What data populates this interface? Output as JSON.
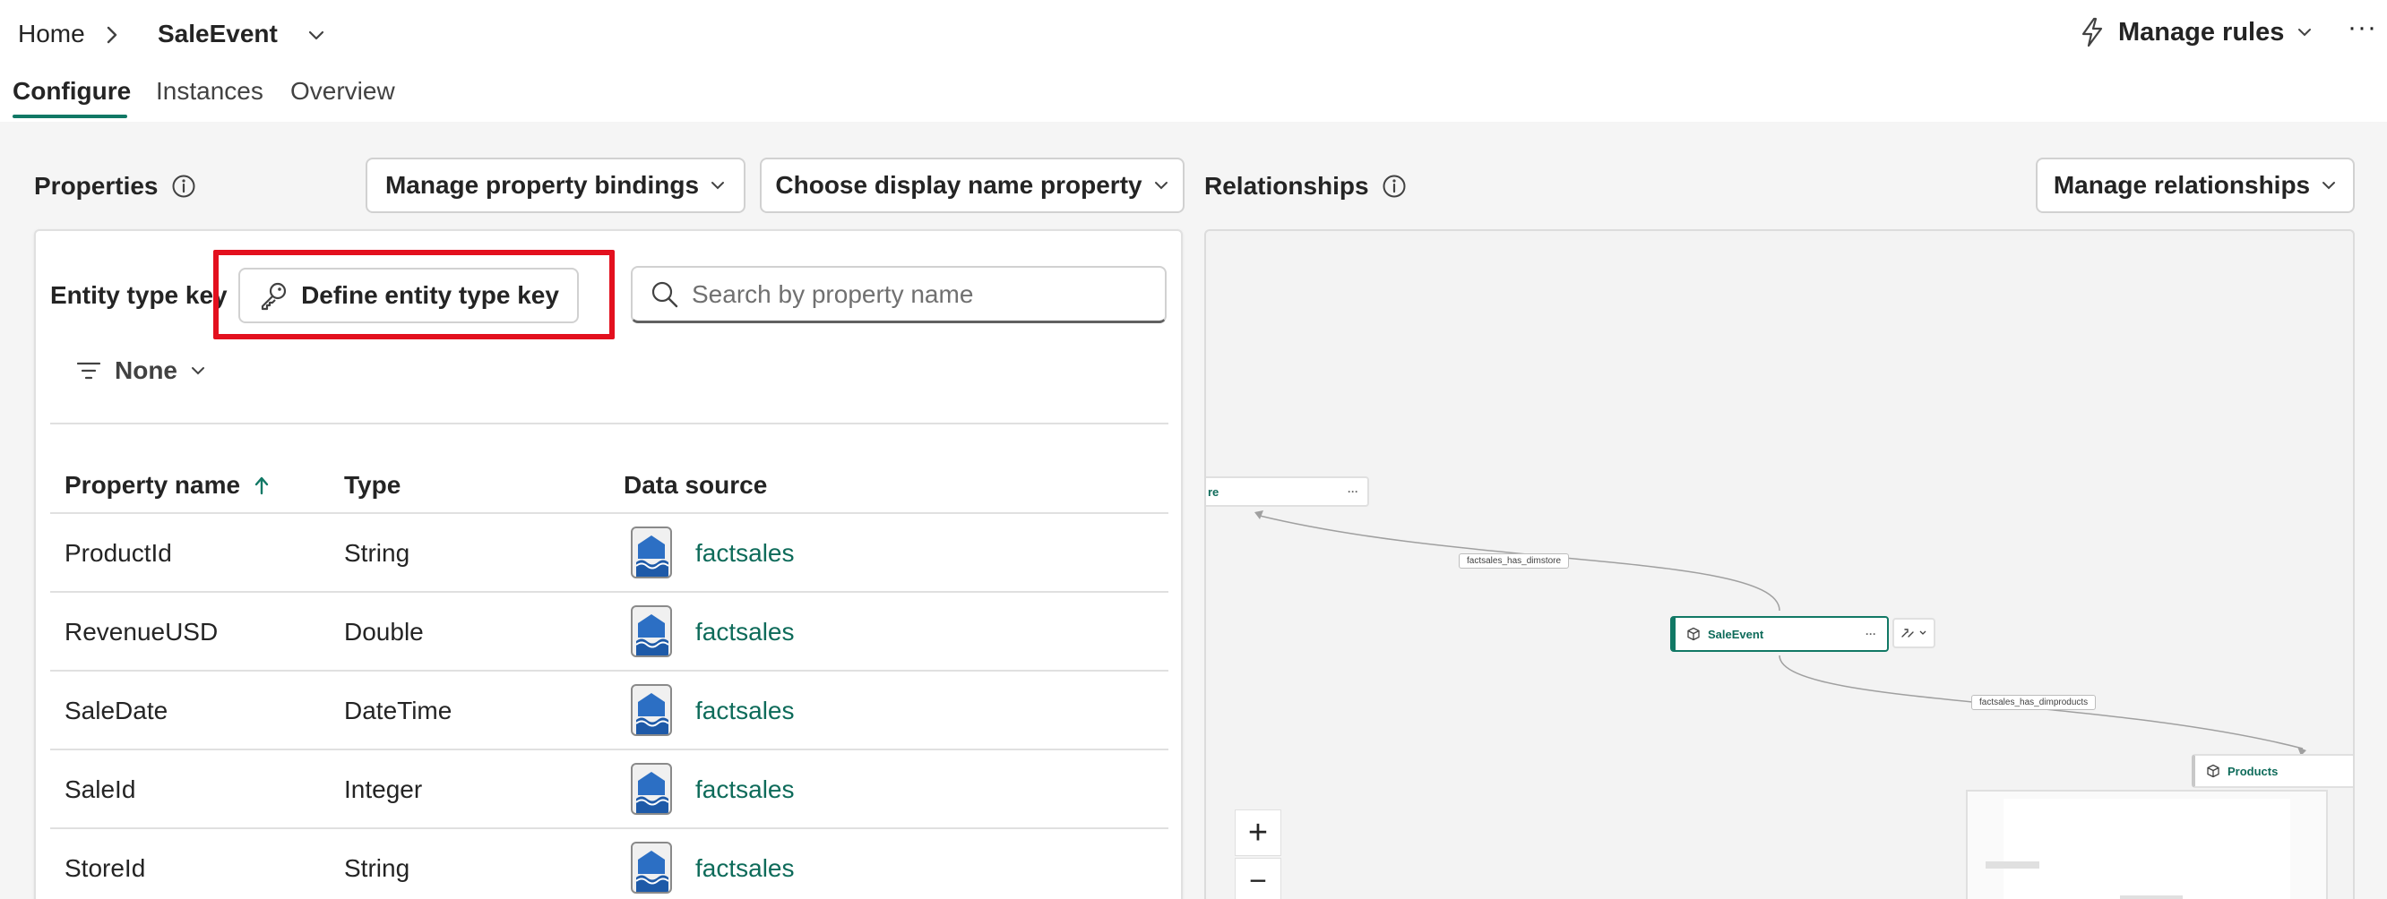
{
  "breadcrumb": {
    "home": "Home",
    "current": "SaleEvent"
  },
  "header": {
    "manage_rules": "Manage rules",
    "more": "···"
  },
  "tabs": [
    "Configure",
    "Instances",
    "Overview"
  ],
  "properties": {
    "title": "Properties",
    "manage_bindings": "Manage property bindings",
    "choose_display": "Choose display name property",
    "entity_type_key_label": "Entity type key",
    "define_key_button": "Define entity type key",
    "search_placeholder": "Search by property name",
    "filter_value": "None",
    "columns": [
      "Property name",
      "Type",
      "Data source"
    ],
    "rows": [
      {
        "name": "ProductId",
        "type": "String",
        "source": "factsales"
      },
      {
        "name": "RevenueUSD",
        "type": "Double",
        "source": "factsales"
      },
      {
        "name": "SaleDate",
        "type": "DateTime",
        "source": "factsales"
      },
      {
        "name": "SaleId",
        "type": "Integer",
        "source": "factsales"
      },
      {
        "name": "StoreId",
        "type": "String",
        "source": "factsales"
      }
    ]
  },
  "relationships": {
    "title": "Relationships",
    "manage_button": "Manage relationships",
    "nodes": {
      "store_partial": "re",
      "sale_event": "SaleEvent",
      "products": "Products"
    },
    "edges": [
      "factsales_has_dimstore",
      "factsales_has_dimproducts"
    ],
    "node_more": "···",
    "zoom_in": "+",
    "zoom_out": "−"
  },
  "colors": {
    "accent": "#117865",
    "link": "#0e6b5a",
    "highlight": "#e3101e"
  }
}
